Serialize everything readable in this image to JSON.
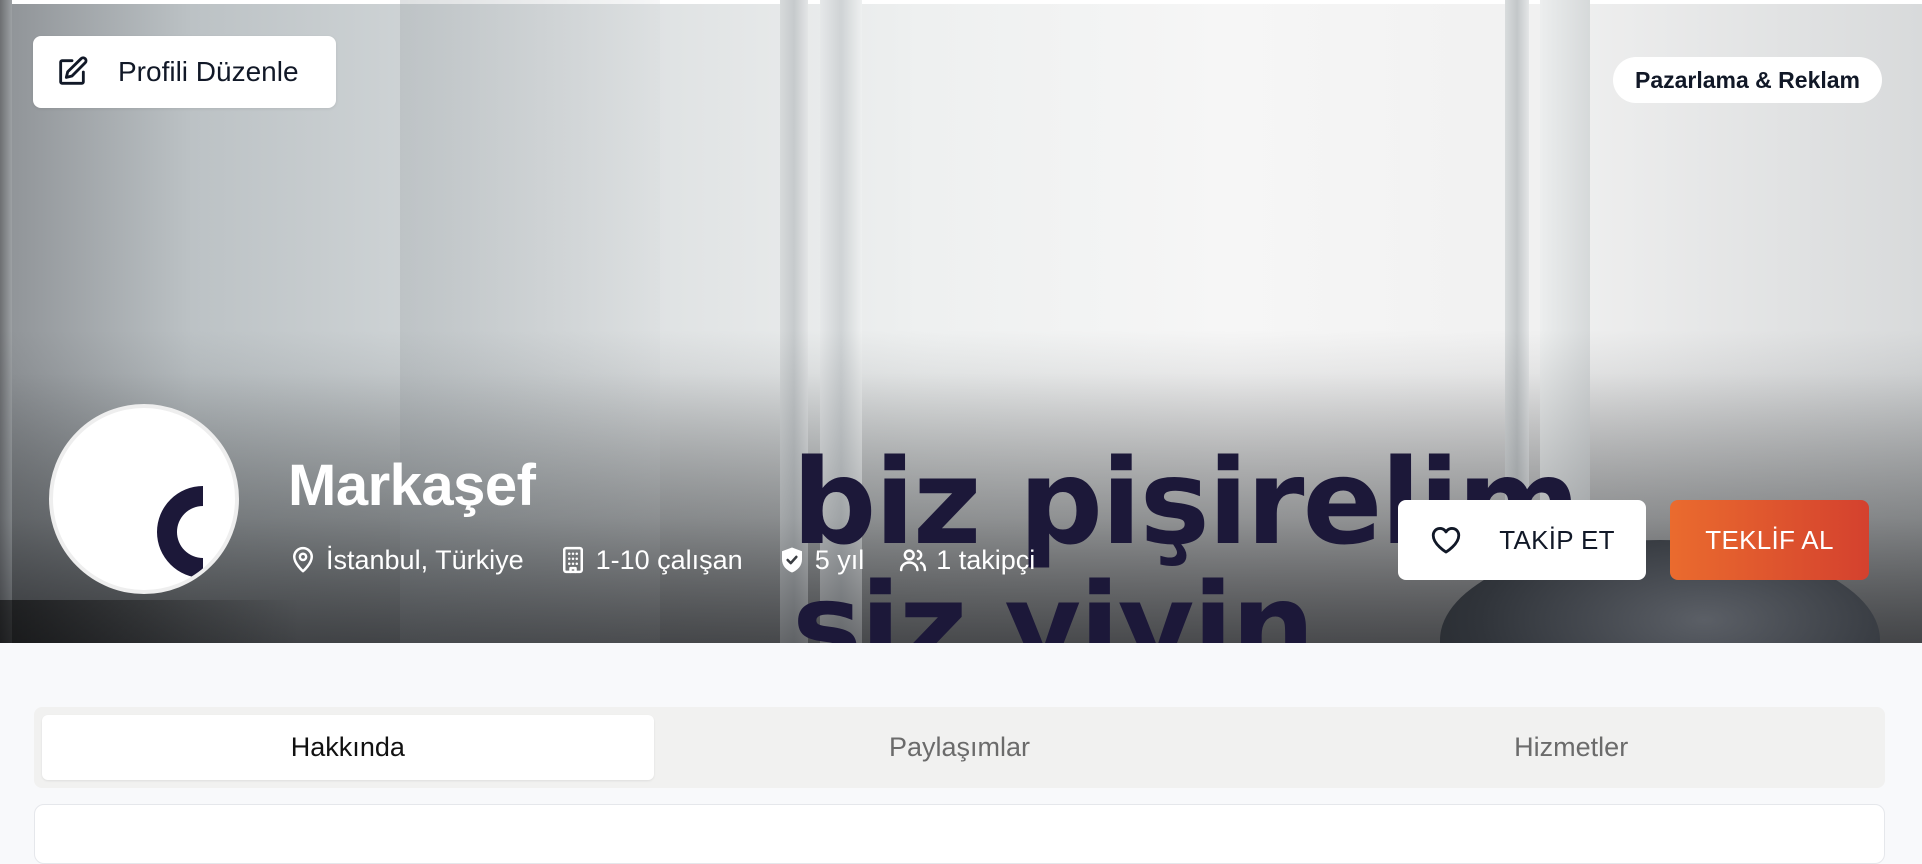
{
  "profile": {
    "edit_label": "Profili Düzenle",
    "category": "Pazarlama & Reklam",
    "name": "Markaşef",
    "location": "İstanbul, Türkiye",
    "employees": "1-10 çalışan",
    "experience": "5 yıl",
    "followers": "1 takipçi"
  },
  "cover": {
    "slogan_line1": "biz pişirelim",
    "slogan_line2": "siz yiyin"
  },
  "actions": {
    "follow_label": "TAKİP ET",
    "quote_label": "TEKLİF AL"
  },
  "tabs": [
    {
      "label": "Hakkında",
      "active": true
    },
    {
      "label": "Paylaşımlar",
      "active": false
    },
    {
      "label": "Hizmetler",
      "active": false
    }
  ],
  "icons": {
    "edit": "edit-icon",
    "location": "map-pin-icon",
    "employees": "building-icon",
    "experience": "shield-check-icon",
    "followers": "users-icon",
    "follow": "heart-icon"
  },
  "colors": {
    "accent_start": "#ea6b2e",
    "accent_end": "#d4412e",
    "logo": "#1c1839"
  }
}
